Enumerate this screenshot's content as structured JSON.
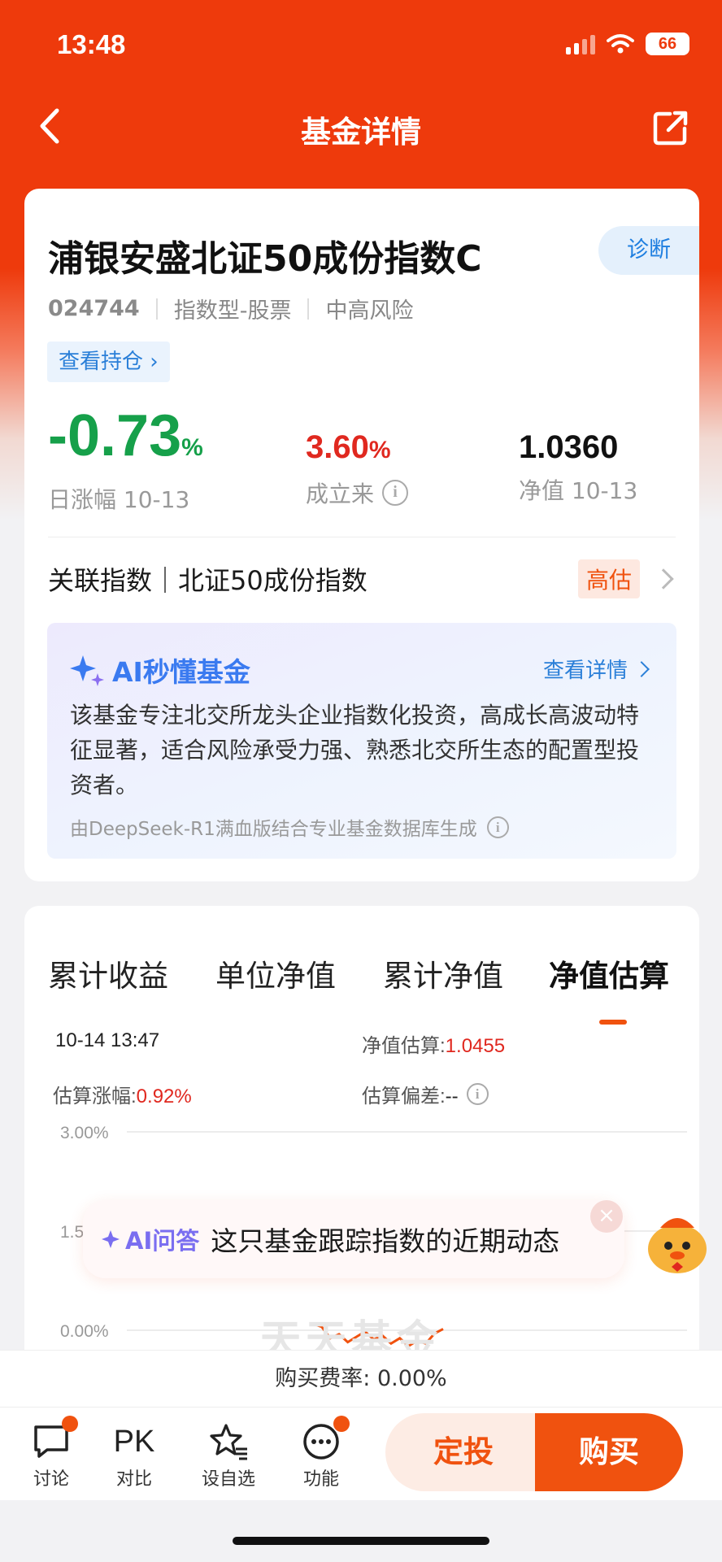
{
  "status_bar": {
    "time": "13:48",
    "battery": "66"
  },
  "nav": {
    "title": "基金详情"
  },
  "fund": {
    "name": "浦银安盛北证50成份指数C",
    "diagnose_label": "诊断",
    "code": "024744",
    "type": "指数型-股票",
    "risk": "中高风险",
    "holdings_label": "查看持仓 ›",
    "daily_change": "-0.73",
    "daily_change_unit": "%",
    "daily_change_label": "日涨幅 10-13",
    "since_inception": "3.60",
    "since_inception_unit": "%",
    "since_inception_label": "成立来",
    "nav_value": "1.0360",
    "nav_label": "净值 10-13"
  },
  "related_index": {
    "text": "关联指数｜北证50成份指数",
    "badge": "高估"
  },
  "ai_summary": {
    "title": "AI秒懂基金",
    "more_label": "查看详情",
    "body": "该基金专注北交所龙头企业指数化投资，高成长高波动特征显著，适合风险承受力强、熟悉北交所生态的配置型投资者。",
    "source": "由DeepSeek-R1满血版结合专业基金数据库生成"
  },
  "tabs": [
    "累计收益",
    "单位净值",
    "累计净值",
    "净值估算"
  ],
  "active_tab": "净值估算",
  "estimate": {
    "timestamp": "10-14 13:47",
    "nav_est_label": "净值估算:",
    "nav_est_value": "1.0455",
    "change_label": "估算涨幅:",
    "change_value": "0.92%",
    "deviation_label": "估算偏差:",
    "deviation_value": "--"
  },
  "chart_data": {
    "type": "line",
    "y_ticks": [
      "3.00%",
      "1.5",
      "0.00%"
    ],
    "ylim": [
      0,
      3.0
    ],
    "x": [
      0,
      1,
      2,
      3,
      4,
      5,
      6,
      7,
      8,
      9,
      10,
      11,
      12,
      13,
      14,
      15
    ],
    "values": [
      0.1,
      0.05,
      -0.12,
      -0.06,
      -0.18,
      -0.1,
      -0.02,
      -0.14,
      -0.08,
      -0.2,
      -0.12,
      -0.24,
      -0.16,
      -0.2,
      -0.05,
      0.02
    ],
    "color": "#f0520f"
  },
  "watermark": "天天基金",
  "ai_prompt": {
    "tag": "AI问答",
    "question": "这只基金跟踪指数的近期动态"
  },
  "fee": "购买费率: 0.00%",
  "bottom_nav": [
    {
      "label": "讨论",
      "icon": "chat-icon"
    },
    {
      "label": "对比",
      "icon": "pk-icon",
      "glyph": "PK"
    },
    {
      "label": "设自选",
      "icon": "star-list-icon"
    },
    {
      "label": "功能",
      "icon": "more-icon"
    }
  ],
  "actions": {
    "sip_label": "定投",
    "buy_label": "购买"
  },
  "colors": {
    "brand": "#ee3a0c",
    "accent": "#f0520f",
    "down": "#16a04a",
    "up": "#e0281f",
    "link": "#2a7fd8"
  }
}
